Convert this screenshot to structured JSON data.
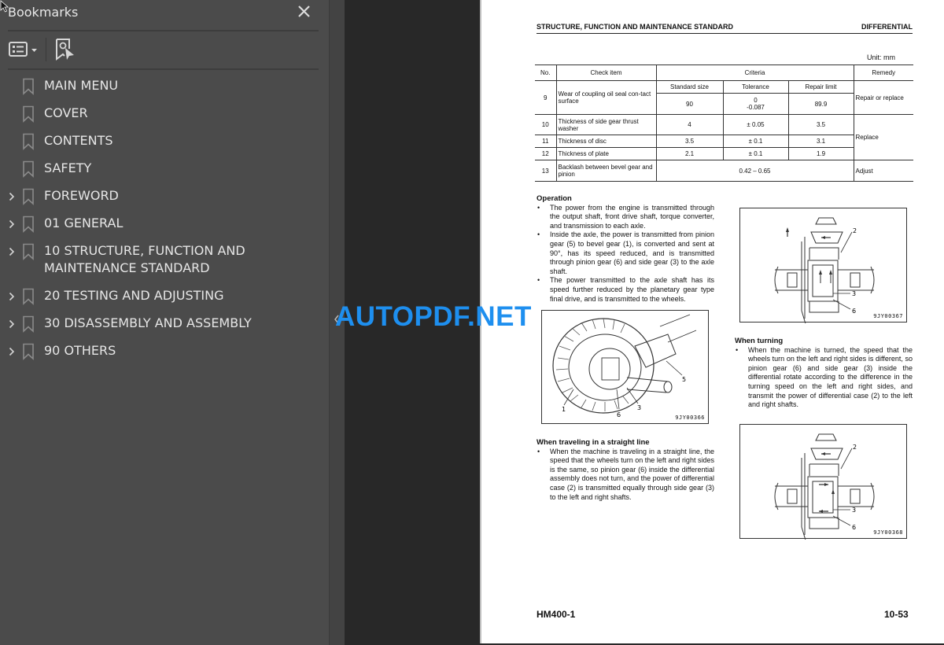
{
  "sidebar": {
    "title": "Bookmarks",
    "close_icon": "close-icon",
    "toolbar": {
      "options_icon": "list-options-icon",
      "find_icon": "find-current-bookmark-icon"
    },
    "items": [
      {
        "label": "MAIN MENU",
        "expandable": false
      },
      {
        "label": "COVER",
        "expandable": false
      },
      {
        "label": "CONTENTS",
        "expandable": false
      },
      {
        "label": "SAFETY",
        "expandable": false
      },
      {
        "label": "FOREWORD",
        "expandable": true
      },
      {
        "label": "01 GENERAL",
        "expandable": true
      },
      {
        "label": "10 STRUCTURE, FUNCTION AND MAINTENANCE STANDARD",
        "expandable": true
      },
      {
        "label": "20 TESTING AND ADJUSTING",
        "expandable": true
      },
      {
        "label": "30 DISASSEMBLY AND ASSEMBLY",
        "expandable": true
      },
      {
        "label": "90 OTHERS",
        "expandable": true
      }
    ]
  },
  "watermark": "AUTOPDF.NET",
  "page": {
    "header_left": "STRUCTURE, FUNCTION AND MAINTENANCE STANDARD",
    "header_right": "DIFFERENTIAL",
    "unit": "Unit: mm",
    "table": {
      "headers": {
        "no": "No.",
        "check_item": "Check item",
        "criteria": "Criteria",
        "remedy": "Remedy",
        "standard_size": "Standard size",
        "tolerance": "Tolerance",
        "repair_limit": "Repair limit"
      },
      "rows": [
        {
          "no": "9",
          "item": "Wear of coupling oil seal con-tact surface",
          "standard": "90",
          "tolerance_upper": "0",
          "tolerance_lower": "-0.087",
          "repair_limit": "89.9",
          "remedy": "Repair or replace"
        },
        {
          "no": "10",
          "item": "Thickness of side gear thrust washer",
          "standard": "4",
          "tolerance": "± 0.05",
          "repair_limit": "3.5",
          "remedy": "Replace"
        },
        {
          "no": "11",
          "item": "Thickness of disc",
          "standard": "3.5",
          "tolerance": "± 0.1",
          "repair_limit": "3.1"
        },
        {
          "no": "12",
          "item": "Thickness of plate",
          "standard": "2.1",
          "tolerance": "± 0.1",
          "repair_limit": "1.9"
        },
        {
          "no": "13",
          "item": "Backlash between bevel gear and pinion",
          "criteria": "0.42 – 0.65",
          "remedy": "Adjust"
        }
      ]
    },
    "operation": {
      "title": "Operation",
      "bullets": [
        "The power from the engine is transmitted through the output shaft, front drive shaft, torque converter, and transmission to each axle.",
        "Inside the axle, the power is transmitted from pinion gear (5) to bevel gear (1), is converted and sent at 90°, has its speed reduced, and is transmitted through pinion gear (6) and side gear (3) to the axle shaft.",
        "The power transmitted to the axle shaft has its speed further reduced by the planetary gear type final drive, and is transmitted to the wheels."
      ]
    },
    "straight": {
      "title": "When traveling in a straight line",
      "bullets": [
        "When the machine is traveling in a straight line, the speed that the wheels turn on the left and right sides is the same, so pinion gear (6) inside the differential assembly does not turn, and the power of differential case (2) is transmitted equally through side gear (3) to the left and right shafts."
      ]
    },
    "turning": {
      "title": "When turning",
      "bullets": [
        "When the machine is turned, the speed that the wheels turn on the left and right sides is different, so pinion gear (6) and side gear (3) inside the differential rotate according to the difference in the turning speed on the left and right sides, and transmit the power of differential case (2) to the left and right shafts."
      ]
    },
    "figures": {
      "gear": {
        "code": "9JY00366",
        "labels": [
          "1",
          "6",
          "3",
          "5"
        ]
      },
      "turning": {
        "code": "9JY00367",
        "labels": [
          "2",
          "3",
          "6"
        ]
      },
      "straight": {
        "code": "9JY00368",
        "labels": [
          "2",
          "3",
          "6"
        ]
      }
    },
    "footer_left": "HM400-1",
    "footer_right": "10-53"
  },
  "colors": {
    "sidebar_bg": "#4b4b4b",
    "canvas_bg": "#282828",
    "watermark": "#1e8fef"
  }
}
